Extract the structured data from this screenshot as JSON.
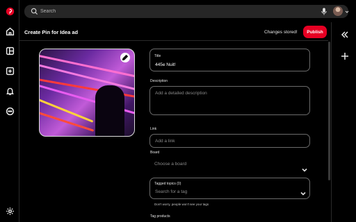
{
  "left_rail": {
    "logo_color": "#e60023",
    "items": [
      {
        "name": "home-icon"
      },
      {
        "name": "layout-icon"
      },
      {
        "name": "create-icon"
      },
      {
        "name": "bell-icon"
      },
      {
        "name": "messages-icon"
      },
      {
        "name": "settings-icon"
      }
    ]
  },
  "search": {
    "placeholder": "Search"
  },
  "header": {
    "title": "Create Pin for Idea ad",
    "status": "Changes stored!",
    "publish_label": "Publish"
  },
  "form": {
    "title": {
      "label": "Title",
      "value": "445e Nuit!"
    },
    "description": {
      "label": "Description",
      "placeholder": "Add a detailed description"
    },
    "link": {
      "label": "Link",
      "placeholder": "Add a link"
    },
    "board": {
      "label": "Board",
      "placeholder": "Choose a board"
    },
    "tagged_topics": {
      "label": "Tagged topics (0)",
      "placeholder": "Search for a tag",
      "helper": "Don't worry, people won't see your tags"
    },
    "tag_products": {
      "label": "Tag products"
    }
  },
  "colors": {
    "accent": "#e60023",
    "background": "#000000",
    "field_border": "#6b6b6b"
  }
}
